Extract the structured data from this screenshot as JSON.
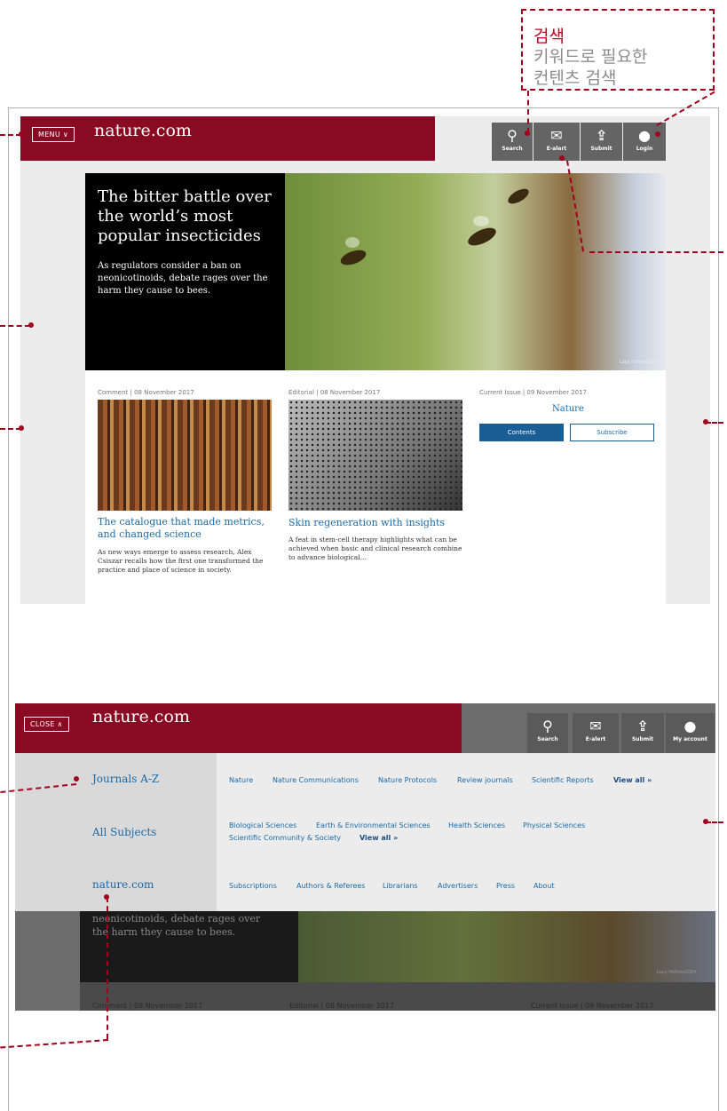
{
  "annotation": {
    "title": "검색",
    "desc_line1": "키워드로 필요한",
    "desc_line2": "컨텐츠 검색"
  },
  "top": {
    "menu_label": "MENU ∨",
    "brand": "nature.com",
    "tools": [
      {
        "label": "Search",
        "icon": "search-icon"
      },
      {
        "label": "E-alert",
        "icon": "mail-icon"
      },
      {
        "label": "Submit",
        "icon": "upload-icon"
      },
      {
        "label": "Login",
        "icon": "user-icon"
      }
    ],
    "hero": {
      "title": "The bitter battle over the world’s most popular insecticides",
      "subtitle": "As regulators consider a ban on neonicotinoids, debate rages over the harm they cause to bees.",
      "credit": "Lucy Holmes/CEH"
    },
    "cards": [
      {
        "meta": "Comment | 08 November 2017",
        "title": "The catalogue that made metrics, and changed science",
        "text": "As new ways emerge to assess research, Alex Csiszar recalls how the first one transformed the practice and place of science in society."
      },
      {
        "meta": "Editorial | 08 November 2017",
        "title": "Skin regeneration with insights",
        "text": "A feat in stem-cell therapy highlights what can be achieved when basic and clinical research combine to advance biological…"
      }
    ],
    "issue": {
      "meta": "Current Issue  |  09 November 2017",
      "name": "Nature",
      "contents": "Contents",
      "subscribe": "Subscribe"
    }
  },
  "bottom": {
    "close_label": "CLOSE ∧",
    "brand": "nature.com",
    "tools": [
      {
        "label": "Search",
        "icon": "search-icon"
      },
      {
        "label": "E-alert",
        "icon": "mail-icon"
      },
      {
        "label": "Submit",
        "icon": "upload-icon"
      },
      {
        "label": "My account",
        "icon": "user-icon"
      }
    ],
    "nav_left": [
      "Journals A-Z",
      "All Subjects",
      "nature.com"
    ],
    "row1": [
      "Nature",
      "Nature Communications",
      "Nature Protocols",
      "Review journals",
      "Scientific Reports"
    ],
    "row1_more": "View all »",
    "row2a": [
      "Biological Sciences",
      "Earth & Environmental Sciences",
      "Health Sciences",
      "Physical Sciences"
    ],
    "row2b": [
      "Scientific Community & Society"
    ],
    "row2_more": "View all »",
    "row3": [
      "Subscriptions",
      "Authors & Referees",
      "Librarians",
      "Advertisers",
      "Press",
      "About"
    ],
    "dim_text1": "neonicotinoids, debate rages over",
    "dim_text2": "the harm they cause to bees.",
    "dim_credit": "Lucy Holmes/CEH",
    "dim_meta": [
      "Comment | 08 November 2017",
      "Editorial | 08 November 2017",
      "Current Issue  |  09 November 2017"
    ]
  },
  "colors": {
    "brand_red": "#8a0a23",
    "link_blue": "#1a6aa8",
    "annotation_red": "#a0001c"
  }
}
